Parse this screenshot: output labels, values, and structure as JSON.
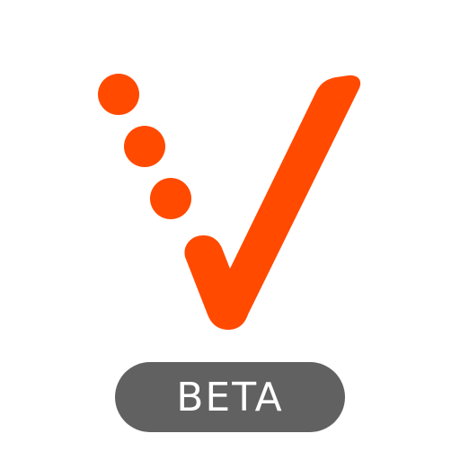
{
  "badge": {
    "label": "BETA"
  },
  "colors": {
    "brand": "#FF4A00",
    "badge_background": "#616161",
    "badge_text": "#FFFFFF",
    "background": "#FFFFFF"
  },
  "icons": {
    "logo": "checkmark-with-dots-logo"
  }
}
